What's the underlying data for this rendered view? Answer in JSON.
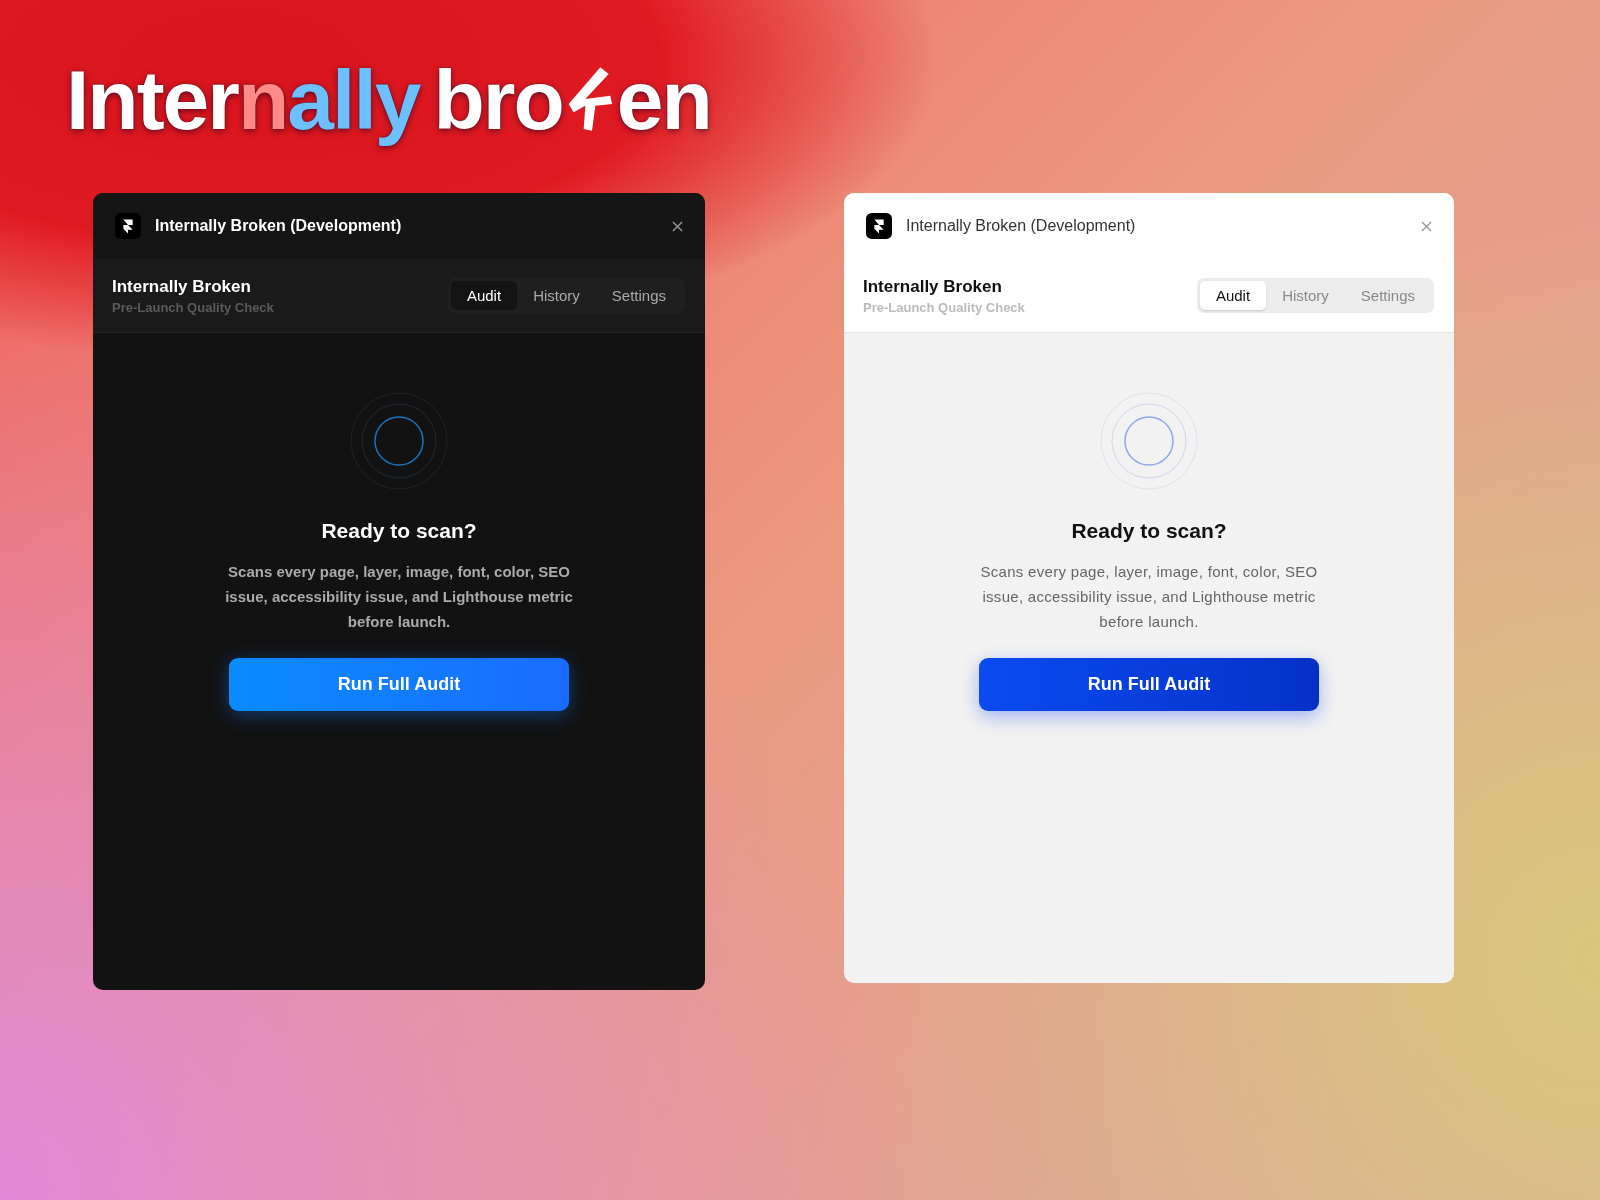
{
  "logo": {
    "first_word": [
      {
        "text": "Inter",
        "color": "#ffffff"
      },
      {
        "text": "n",
        "color": "#ff8a8a"
      },
      {
        "text": "ally",
        "color": "#6cc0ff"
      }
    ],
    "second_word_start": "bro",
    "second_word_end": "en"
  },
  "windows": [
    {
      "kind": "dark",
      "title": "Internally Broken (Development)",
      "app_name": "Internally Broken",
      "subtitle": "Pre-Launch Quality Check",
      "tabs": [
        {
          "label": "Audit",
          "selected": true
        },
        {
          "label": "History",
          "selected": false
        },
        {
          "label": "Settings",
          "selected": false
        }
      ],
      "heading": "Ready to scan?",
      "description": "Scans every page, layer, image, font, color, SEO issue, accessibility issue, and Lighthouse metric before launch.",
      "button": "Run Full Audit"
    },
    {
      "kind": "light",
      "title": "Internally Broken (Development)",
      "app_name": "Internally Broken",
      "subtitle": "Pre-Launch Quality Check",
      "tabs": [
        {
          "label": "Audit",
          "selected": true
        },
        {
          "label": "History",
          "selected": false
        },
        {
          "label": "Settings",
          "selected": false
        }
      ],
      "heading": "Ready to scan?",
      "description": "Scans every page, layer, image, font, color, SEO issue, accessibility issue, and Lighthouse metric before launch.",
      "button": "Run Full Audit"
    }
  ]
}
